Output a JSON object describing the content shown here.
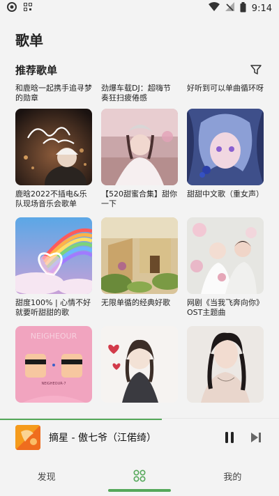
{
  "status": {
    "time": "9:14"
  },
  "page": {
    "title": "歌单"
  },
  "section": {
    "title": "推荐歌单"
  },
  "playlists": [
    {
      "title": "和鹿晗一起携手追寻梦的勋章"
    },
    {
      "title": "劲爆车载DJ：超嗨节奏狂扫疲倦感"
    },
    {
      "title": "好听到可以单曲循环呀"
    },
    {
      "title": "鹿晗2022不插电&乐队现场音乐会歌单"
    },
    {
      "title": "【520甜蜜合集】甜你一下"
    },
    {
      "title": "甜甜中文歌（重女声）"
    },
    {
      "title": "甜度100% | 心情不好就要听甜甜的歌"
    },
    {
      "title": "无限单循的经典好歌"
    },
    {
      "title": "网剧《当我飞奔向你》OST主题曲"
    }
  ],
  "covers": {
    "c1_text": "鹿晗2022",
    "c1_hand": "如果不见 出来聊聊",
    "c10_text": "NEIGHEOUR",
    "c10_sub": "NEIGHEOUR-7"
  },
  "player": {
    "title": "摘星 - 傲七爷（江偌绮）",
    "progress": 0.58
  },
  "nav": {
    "discover": "发现",
    "mine": "我的"
  },
  "colors": {
    "accent": "#55a85a"
  }
}
